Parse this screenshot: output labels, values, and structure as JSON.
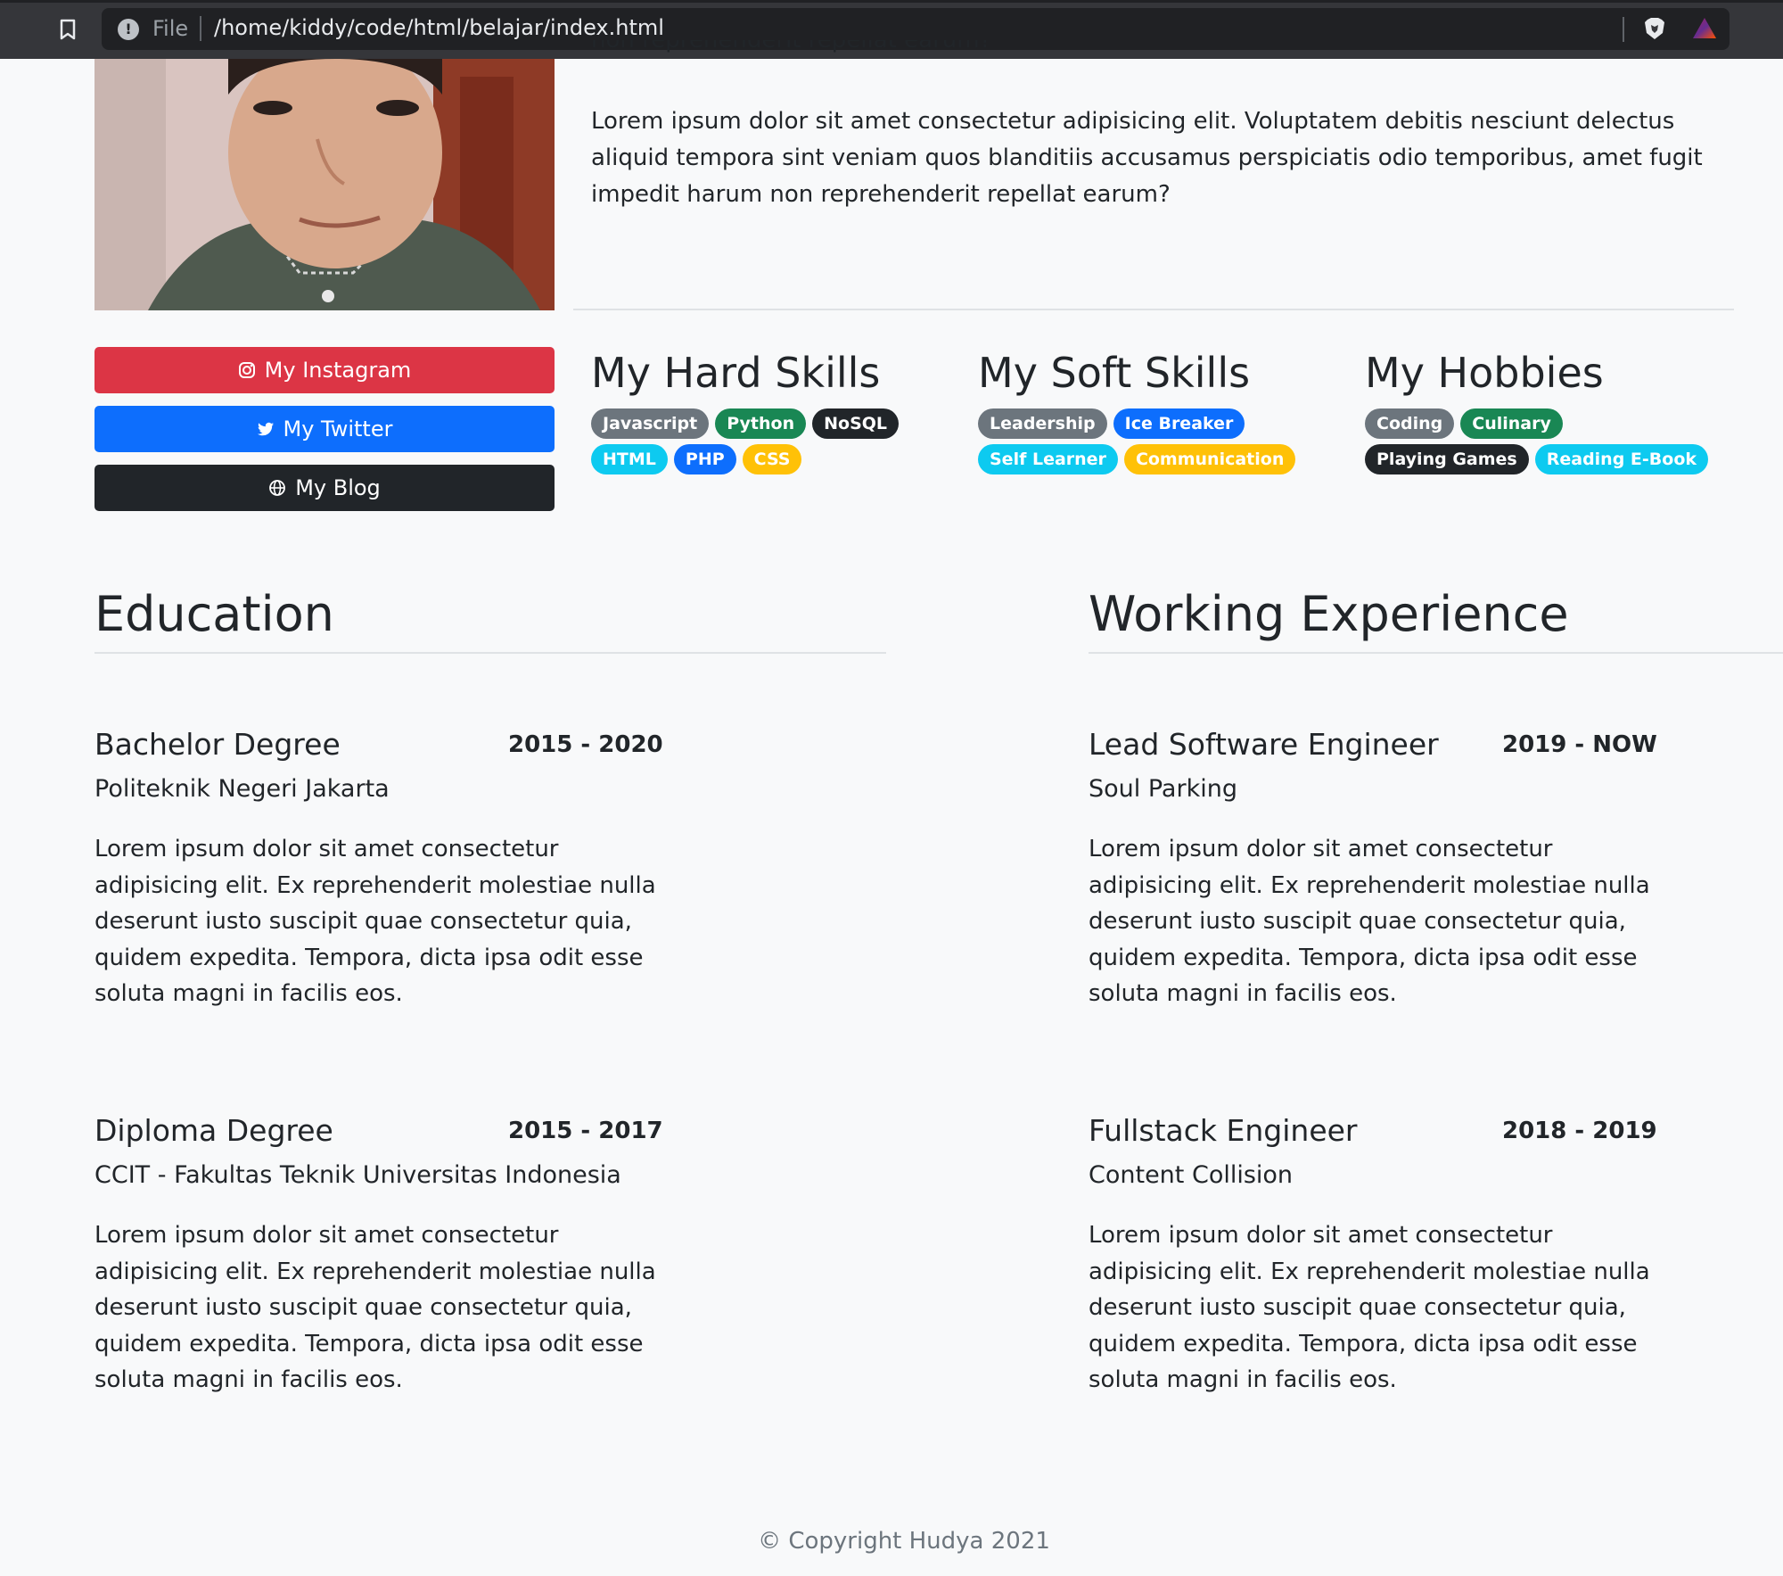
{
  "browser": {
    "file_label": "File",
    "url": "/home/kiddy/code/html/belajar/index.html",
    "icons": [
      "bookmark-icon",
      "info-icon",
      "brave-shield-icon",
      "brave-rewards-icon"
    ]
  },
  "about": {
    "paragraph_cut": "non reprehenderit repellat earum?",
    "paragraph": "Lorem ipsum dolor sit amet consectetur adipisicing elit. Voluptatem debitis nesciunt delectus aliquid tempora sint veniam quos blanditiis accusamus perspiciatis odio temporibus, amet fugit impedit harum non reprehenderit repellat earum?"
  },
  "social": {
    "instagram": "My Instagram",
    "twitter": "My Twitter",
    "blog": "My Blog",
    "colors": {
      "instagram": "#dc3545",
      "twitter": "#0d6efd",
      "blog": "#212529"
    }
  },
  "skills": {
    "hard": {
      "title": "My Hard Skills",
      "badges": [
        {
          "label": "Javascript",
          "color": "secondary"
        },
        {
          "label": "Python",
          "color": "success"
        },
        {
          "label": "NoSQL",
          "color": "dark"
        },
        {
          "label": "HTML",
          "color": "info"
        },
        {
          "label": "PHP",
          "color": "primary"
        },
        {
          "label": "CSS",
          "color": "warning"
        }
      ]
    },
    "soft": {
      "title": "My Soft Skills",
      "badges": [
        {
          "label": "Leadership",
          "color": "secondary"
        },
        {
          "label": "Ice Breaker",
          "color": "primary"
        },
        {
          "label": "Self Learner",
          "color": "info"
        },
        {
          "label": "Communication",
          "color": "warning"
        }
      ]
    },
    "hobbies": {
      "title": "My Hobbies",
      "badges": [
        {
          "label": "Coding",
          "color": "secondary"
        },
        {
          "label": "Culinary",
          "color": "success"
        },
        {
          "label": "Playing Games",
          "color": "dark"
        },
        {
          "label": "Reading E-Book",
          "color": "info"
        }
      ]
    }
  },
  "education": {
    "title": "Education",
    "entries": [
      {
        "title": "Bachelor Degree",
        "period": "2015 - 2020",
        "place": "Politeknik Negeri Jakarta",
        "desc": "Lorem ipsum dolor sit amet consectetur adipisicing elit. Ex reprehenderit molestiae nulla deserunt iusto suscipit quae consectetur quia, quidem expedita. Tempora, dicta ipsa odit esse soluta magni in facilis eos."
      },
      {
        "title": "Diploma Degree",
        "period": "2015 - 2017",
        "place": "CCIT - Fakultas Teknik Universitas Indonesia",
        "desc": "Lorem ipsum dolor sit amet consectetur adipisicing elit. Ex reprehenderit molestiae nulla deserunt iusto suscipit quae consectetur quia, quidem expedita. Tempora, dicta ipsa odit esse soluta magni in facilis eos."
      }
    ]
  },
  "work": {
    "title": "Working Experience",
    "entries": [
      {
        "title": "Lead Software Engineer",
        "period": "2019 - NOW",
        "place": "Soul Parking",
        "desc": "Lorem ipsum dolor sit amet consectetur adipisicing elit. Ex reprehenderit molestiae nulla deserunt iusto suscipit quae consectetur quia, quidem expedita. Tempora, dicta ipsa odit esse soluta magni in facilis eos."
      },
      {
        "title": "Fullstack Engineer",
        "period": "2018 - 2019",
        "place": "Content Collision",
        "desc": "Lorem ipsum dolor sit amet consectetur adipisicing elit. Ex reprehenderit molestiae nulla deserunt iusto suscipit quae consectetur quia, quidem expedita. Tempora, dicta ipsa odit esse soluta magni in facilis eos."
      }
    ]
  },
  "footer": {
    "text": "© Copyright Hudya 2021"
  }
}
